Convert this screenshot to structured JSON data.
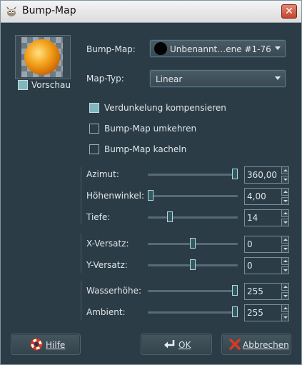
{
  "window": {
    "title": "Bump-Map"
  },
  "preview": {
    "label": "Vorschau",
    "checked": true
  },
  "bumpmap": {
    "label": "Bump-Map:",
    "value": "Unbenannt…ene #1-76"
  },
  "maptype": {
    "label": "Map-Typ:",
    "value": "Linear"
  },
  "options": [
    {
      "label": "Verdunkelung kompensieren",
      "checked": true
    },
    {
      "label": "Bump-Map umkehren",
      "checked": false
    },
    {
      "label": "Bump-Map kacheln",
      "checked": false
    }
  ],
  "sliders": [
    {
      "label": "Azimut:",
      "value": "360,00",
      "level": 1.0
    },
    {
      "label": "Höhenwinkel:",
      "value": "4,00",
      "level": 0.0
    },
    {
      "label": "Tiefe:",
      "value": "14",
      "level": 0.23
    },
    {
      "label": "X-Versatz:",
      "value": "0",
      "level": 0.5
    },
    {
      "label": "Y-Versatz:",
      "value": "0",
      "level": 0.5
    },
    {
      "label": "Wasserhöhe:",
      "value": "255",
      "level": 1.0
    },
    {
      "label": "Ambient:",
      "value": "255",
      "level": 1.0
    }
  ],
  "buttons": {
    "help": "Hilfe",
    "ok": "OK",
    "cancel": "Abbrechen"
  },
  "icons": {
    "title": "gimp-icon",
    "close": "close-icon",
    "help": "lifebuoy-icon",
    "ok": "enter-arrow-icon",
    "cancel": "red-x-icon"
  },
  "colors": {
    "background": "#2c3c46",
    "accent": "#7fb7bd"
  }
}
